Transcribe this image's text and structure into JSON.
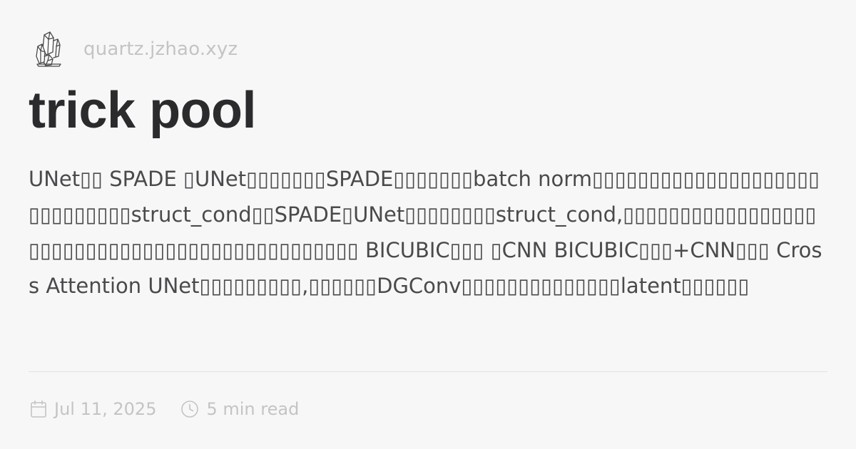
{
  "site": {
    "logo_icon": "crystal-icon",
    "name": "quartz.jzhao.xyz"
  },
  "page": {
    "title": "trick pool",
    "description": "UNet▯▯ SPADE ▯UNet▯▯▯▯▯▯▯SPADE▯▯▯▯▯▯▯batch norm▯▯▯▯▯▯▯▯▯▯▯▯▯▯▯▯▯▯▯▯▯▯▯▯▯▯▯▯▯struct_cond▯▯SPADE▯UNet▯▯▯▯▯▯▯▯struct_cond,▯▯▯▯▯▯▯▯▯▯▯▯▯▯▯▯▯▯▯▯▯▯▯▯▯▯▯▯▯▯▯▯▯▯▯▯▯▯▯▯▯▯▯▯▯▯ BICUBIC▯▯▯ ▯CNN BICUBIC▯▯▯+CNN▯▯▯ Cross Attention UNet▯▯▯▯▯▯▯▯▯,▯▯▯▯▯▯DGConv▯▯▯▯▯▯▯▯▯▯▯▯▯▯latent▯▯▯▯▯▯"
  },
  "meta": {
    "date_icon": "calendar-icon",
    "date": "Jul 11, 2025",
    "read_icon": "clock-icon",
    "read_time": "5 min read"
  },
  "colors": {
    "background": "#f7f7f8",
    "title": "#2b2b2e",
    "body_text": "#4a4a4d",
    "muted": "#c4c4c6",
    "divider": "#e2e2e4"
  }
}
